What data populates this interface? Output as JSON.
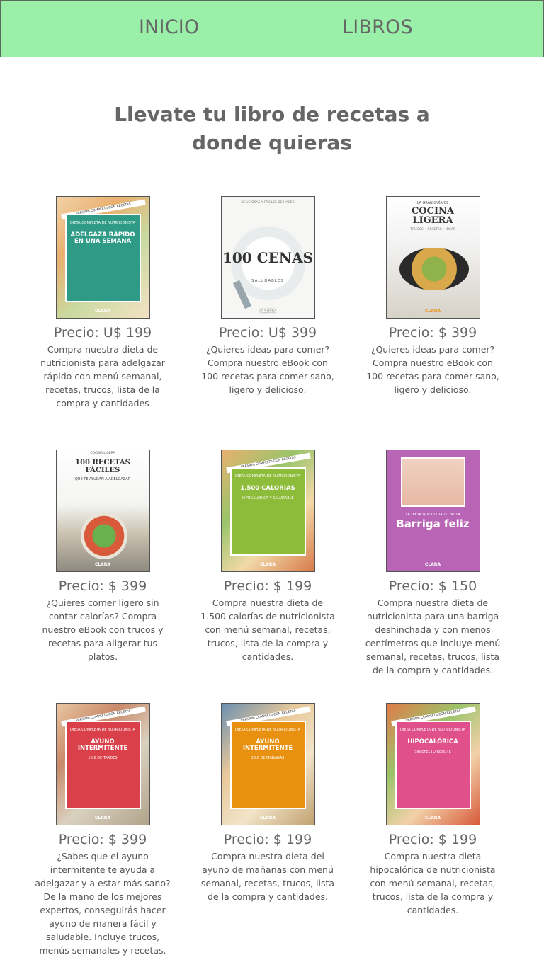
{
  "nav": {
    "inicio": "INICIO",
    "libros": "LIBROS"
  },
  "title_line1": "Llevate tu libro de recetas a",
  "title_line2": "donde quieras",
  "colors": {
    "navbar": "#9af0a8",
    "text": "#666666"
  },
  "books": [
    {
      "price": "Precio: U$ 199",
      "desc": "Compra nuestra dieta de nutricionista para adelgazar rápido con menú semanal, recetas, trucos, lista de la compra y cantidades",
      "cover": {
        "ribbon": "VERSIÓN COMPLETA CON RECETAS",
        "small": "DIETA COMPLETA DE NUTRICIONISTA",
        "big": "ADELGAZA RÁPIDO EN UNA SEMANA",
        "foot": "CLARA",
        "panel": "#2f9b86"
      }
    },
    {
      "price": "Precio: U$ 399",
      "desc": "¿Quieres ideas para comer? Compra nuestro eBook con 100 recetas para comer sano, ligero y delicioso.",
      "cover": {
        "top": "DELICIOSAS Y FÁCILES DE HACER",
        "big": "100 CENAS",
        "sub": "SALUDABLES",
        "foot": "CLARA"
      }
    },
    {
      "price": "Precio: $ 399",
      "desc": "¿Quieres ideas para comer? Compra nuestro eBook con 100 recetas para comer sano, ligero y delicioso.",
      "cover": {
        "top": "LA GRAN GUÍA DE",
        "big": "COCINA LIGERA",
        "sub": "TRUCOS • RECETAS • IDEAS",
        "foot": "CLARA"
      }
    },
    {
      "price": "Precio: $ 399",
      "desc": "¿Quieres comer ligero sin contar calorías? Compra nuestro eBook con trucos y recetas para aligerar tus platos.",
      "cover": {
        "top": "COCINA LIGERA",
        "big": "100 RECETAS FÁCILES",
        "sub": "QUE TE AYUDAN A ADELGAZAR",
        "foot": "CLARA"
      }
    },
    {
      "price": "Precio: $ 199",
      "desc": "Compra nuestra dieta de 1.500 calorías de nutricionista con menú semanal, recetas, trucos, lista de la compra y cantidades.",
      "cover": {
        "ribbon": "VERSIÓN COMPLETA CON RECETAS",
        "small": "DIETA COMPLETA DE NUTRICIONISTA",
        "big": "1.500 CALORIAS",
        "sub": "HIPOCALÓRICA Y SALUDABLE",
        "foot": "CLARA",
        "panel": "#8dbb3a"
      }
    },
    {
      "price": "Precio: $ 150",
      "desc": "Compra nuestra dieta de nutricionista para una barriga deshinchada y con menos centímetros que incluye menú semanal, recetas, trucos, lista de la compra y cantidades.",
      "cover": {
        "small": "LA DIETA QUE CUIDA TU BIOTA",
        "big": "Barriga feliz",
        "foot": "CLARA",
        "panel": "#b865b5"
      }
    },
    {
      "price": "Precio: $ 399",
      "desc": "¿Sabes que el ayuno intermitente te ayuda a adelgazar y a estar más sano? De la mano de los mejores expertos, conseguirás hacer ayuno de manera fácil y saludable. Incluye trucos, menús semanales y recetas.",
      "cover": {
        "ribbon": "VERSIÓN COMPLETA CON RECETAS",
        "small": "DIETA COMPLETA DE NUTRICIONISTA",
        "big": "AYUNO INTERMITENTE",
        "sub": "16:8 DE TARDES",
        "foot": "CLARA",
        "panel": "#d9404a"
      }
    },
    {
      "price": "Precio: $ 199",
      "desc": "Compra nuestra dieta del ayuno de mañanas con menú semanal, recetas, trucos, lista de la compra y cantidades.",
      "cover": {
        "ribbon": "VERSIÓN COMPLETA CON RECETAS",
        "small": "DIETA COMPLETA DE NUTRICIONISTA",
        "big": "AYUNO INTERMITENTE",
        "sub": "16:8 DE MAÑANAS",
        "foot": "CLARA",
        "panel": "#e8900f"
      }
    },
    {
      "price": "Precio: $ 199",
      "desc": "Compra nuestra dieta hipocalórica de nutricionista con menú semanal, recetas, trucos, lista de la compra y cantidades.",
      "cover": {
        "ribbon": "VERSIÓN COMPLETA CON RECETAS",
        "small": "DIETA COMPLETA DE NUTRICIONISTA",
        "big": "HIPOCALÓRICA",
        "sub": "SIN EFECTO REBOTE",
        "foot": "CLARA",
        "panel": "#e0508a"
      }
    }
  ]
}
